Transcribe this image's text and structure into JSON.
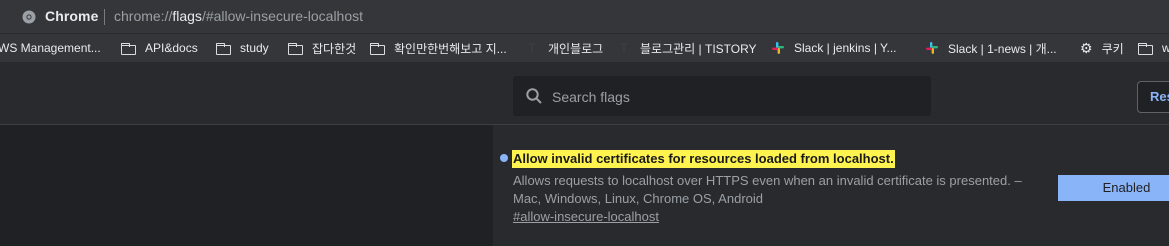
{
  "omnibox": {
    "app_label": "Chrome",
    "url_prefix": "chrome://",
    "url_host": "flags",
    "url_rest": "/#allow-insecure-localhost"
  },
  "bookmarks": [
    {
      "label": "WS Management...",
      "icon": "folder-icon"
    },
    {
      "label": "API&docs",
      "icon": "folder-icon"
    },
    {
      "label": "study",
      "icon": "folder-icon"
    },
    {
      "label": "잡다한것",
      "icon": "folder-icon"
    },
    {
      "label": "확인만한번해보고 지...",
      "icon": "folder-icon"
    },
    {
      "label": "개인블로그",
      "icon": "tistory-icon"
    },
    {
      "label": "블로그관리 | TISTORY",
      "icon": "tistory-icon"
    },
    {
      "label": "Slack | jenkins | Y...",
      "icon": "slack-icon"
    },
    {
      "label": "Slack | 1-news | 개...",
      "icon": "slack-icon"
    },
    {
      "label": "쿠키",
      "icon": "gear-icon"
    },
    {
      "label": "w",
      "icon": "folder-icon"
    }
  ],
  "search": {
    "placeholder": "Search flags"
  },
  "reset_button": {
    "label": "Res"
  },
  "flag": {
    "title": "Allow invalid certificates for resources loaded from localhost.",
    "description": "Allows requests to localhost over HTTPS even when an invalid certificate is presented. – Mac, Windows, Linux, Chrome OS, Android",
    "anchor": "#allow-insecure-localhost",
    "state": "Enabled"
  },
  "colors": {
    "highlight": "#fff44f",
    "accent": "#8ab4f8",
    "page_bg": "#202124"
  }
}
